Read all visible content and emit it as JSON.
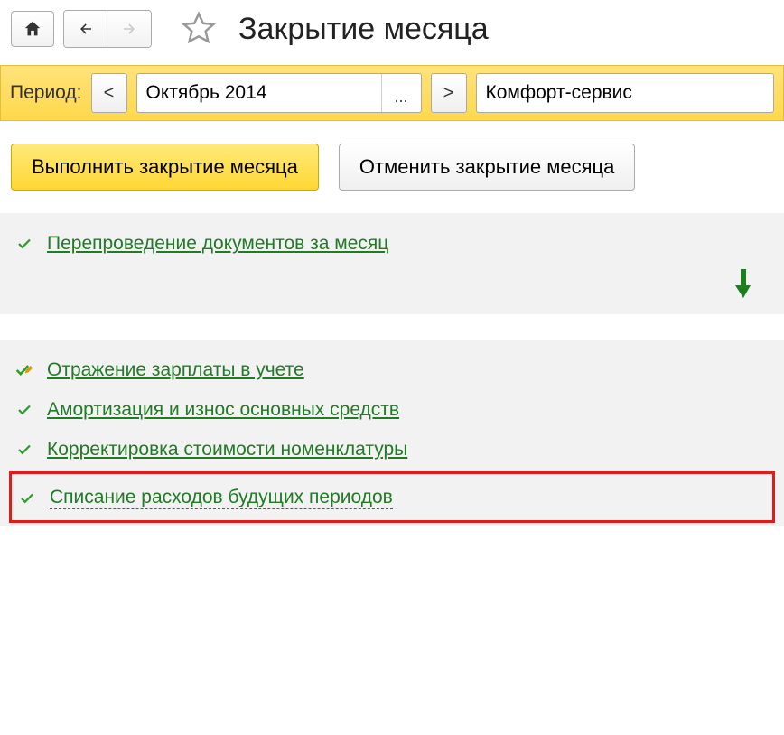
{
  "title": "Закрытие месяца",
  "period": {
    "label": "Период:",
    "prev": "<",
    "value": "Октябрь 2014",
    "ellipsis": "...",
    "next": ">",
    "org": "Комфорт-сервис"
  },
  "actions": {
    "execute": "Выполнить закрытие месяца",
    "cancel": "Отменить закрытие месяца"
  },
  "operations": {
    "first": "Перепроведение документов за месяц",
    "list": [
      "Отражение зарплаты в учете",
      "Амортизация и износ основных средств",
      "Корректировка стоимости номенклатуры"
    ],
    "highlighted": "Списание расходов будущих периодов"
  }
}
